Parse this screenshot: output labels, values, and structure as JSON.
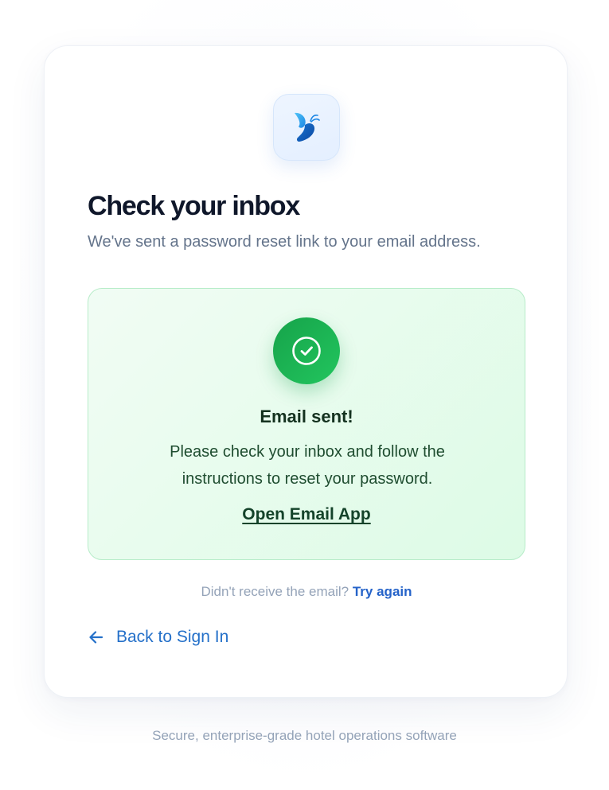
{
  "brand": {
    "logo_icon": "butterfly-logo-icon",
    "accent_color": "#2470c9"
  },
  "header": {
    "title": "Check your inbox",
    "subtitle": "We've sent a password reset link to your email address."
  },
  "success": {
    "icon": "check-circle-icon",
    "title": "Email sent!",
    "body": "Please check your inbox and follow the instructions to reset your password.",
    "open_app_label": "Open Email App",
    "color": "#22c55e"
  },
  "retry": {
    "prompt": "Didn't receive the email?",
    "link_label": "Try again"
  },
  "back": {
    "icon": "arrow-left-icon",
    "label": "Back to Sign In"
  },
  "footer": {
    "tagline": "Secure, enterprise-grade hotel operations software"
  }
}
